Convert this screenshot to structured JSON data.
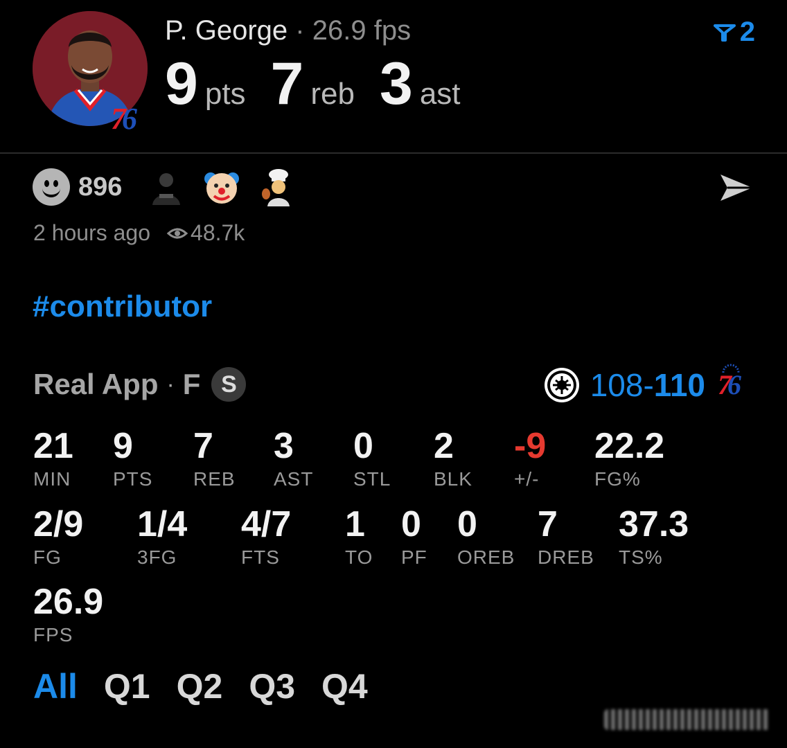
{
  "header": {
    "player_name": "P. George",
    "separator": "·",
    "fps_text": "26.9 fps",
    "team_badge": {
      "digit_red": "7",
      "digit_blue": "6"
    },
    "summary": [
      {
        "value": "9",
        "unit": "pts"
      },
      {
        "value": "7",
        "unit": "reb"
      },
      {
        "value": "3",
        "unit": "ast"
      }
    ],
    "filter_count": "2"
  },
  "reactions": {
    "count": "896",
    "emojis": [
      "nets-player-icon",
      "clown-icon",
      "chef-icon"
    ]
  },
  "meta": {
    "time_ago": "2 hours ago",
    "views": "48.7k"
  },
  "hashtag": "#contributor",
  "game": {
    "source": "Real App",
    "separator": "·",
    "status": "F",
    "badge": "S",
    "score_away": "108",
    "score_dash": "-",
    "score_home": "110",
    "home_logo": {
      "digit_red": "7",
      "digit_blue": "6"
    }
  },
  "stats": [
    {
      "value": "21",
      "label": "MIN"
    },
    {
      "value": "9",
      "label": "PTS"
    },
    {
      "value": "7",
      "label": "REB"
    },
    {
      "value": "3",
      "label": "AST"
    },
    {
      "value": "0",
      "label": "STL"
    },
    {
      "value": "2",
      "label": "BLK"
    },
    {
      "value": "-9",
      "label": "+/-"
    },
    {
      "value": "22.2",
      "label": "FG%"
    },
    {
      "value": "2/9",
      "label": "FG"
    },
    {
      "value": "1/4",
      "label": "3FG"
    },
    {
      "value": "4/7",
      "label": "FTS"
    },
    {
      "value": "1",
      "label": "TO"
    },
    {
      "value": "0",
      "label": "PF"
    },
    {
      "value": "0",
      "label": "OREB"
    },
    {
      "value": "7",
      "label": "DREB"
    },
    {
      "value": "37.3",
      "label": "TS%"
    },
    {
      "value": "26.9",
      "label": "FPS"
    }
  ],
  "tabs": [
    {
      "label": "All",
      "active": true
    },
    {
      "label": "Q1"
    },
    {
      "label": "Q2"
    },
    {
      "label": "Q3"
    },
    {
      "label": "Q4"
    }
  ],
  "colors": {
    "accent": "#1c8bea",
    "negative": "#e63a30",
    "background": "#000000"
  }
}
